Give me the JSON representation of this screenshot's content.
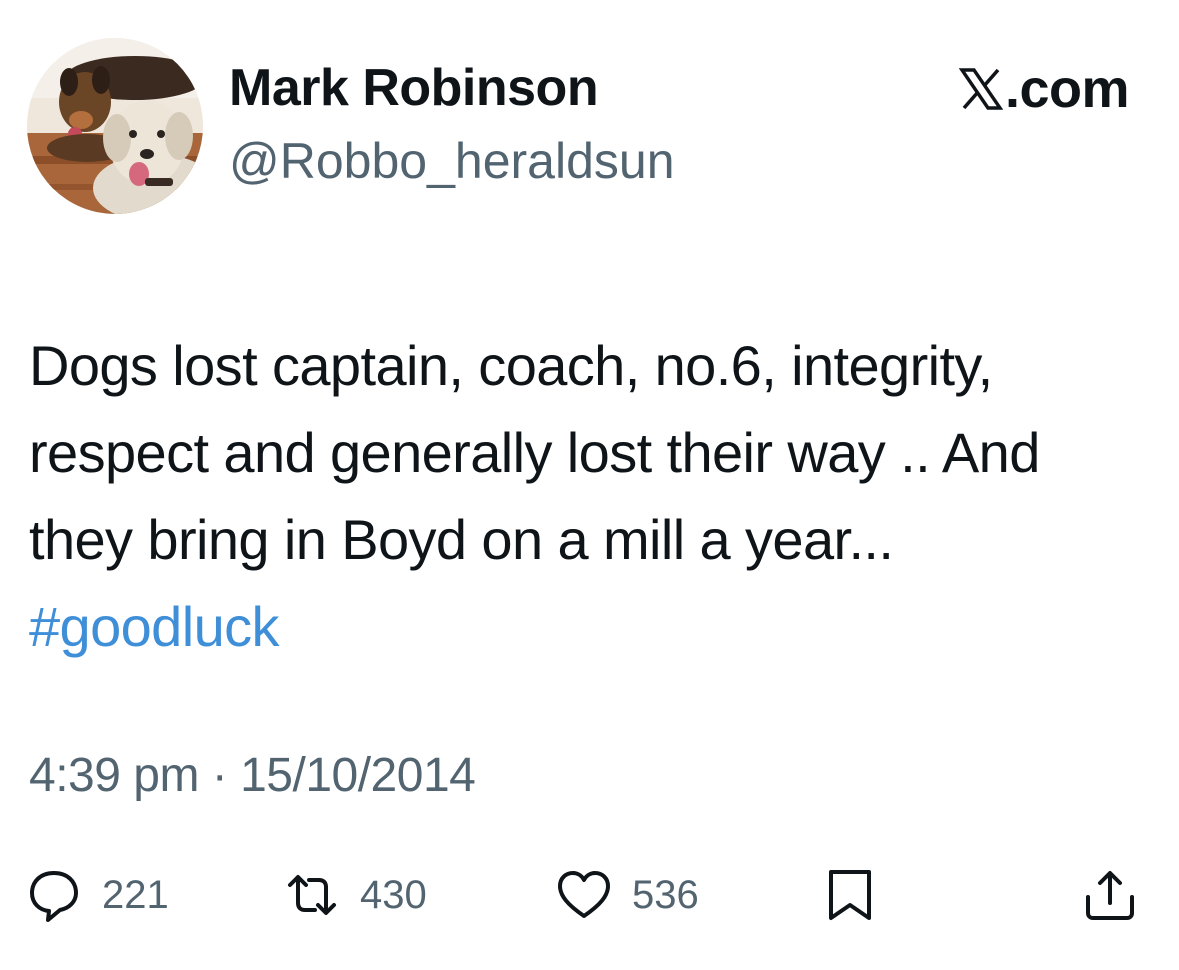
{
  "author": {
    "display_name": "Mark Robinson",
    "handle": "@Robbo_heraldsun",
    "avatar_icon": "avatar-photo-two-dogs"
  },
  "brand": {
    "label": ".com",
    "logo_icon": "x-logo-icon"
  },
  "tweet": {
    "text": "Dogs lost captain, coach, no.6, integrity, respect and generally lost their way .. And they bring in Boyd on a mill a year... ",
    "hashtag": "#goodluck",
    "time": "4:39 pm",
    "separator": " · ",
    "date": "15/10/2014"
  },
  "actions": {
    "reply": {
      "icon": "reply-icon",
      "count": "221"
    },
    "retweet": {
      "icon": "retweet-icon",
      "count": "430"
    },
    "like": {
      "icon": "heart-icon",
      "count": "536"
    },
    "bookmark": {
      "icon": "bookmark-icon"
    },
    "share": {
      "icon": "share-icon"
    }
  },
  "colors": {
    "text": "#0f1419",
    "secondary": "#536471",
    "link": "#3f8fd8",
    "background": "#ffffff"
  }
}
